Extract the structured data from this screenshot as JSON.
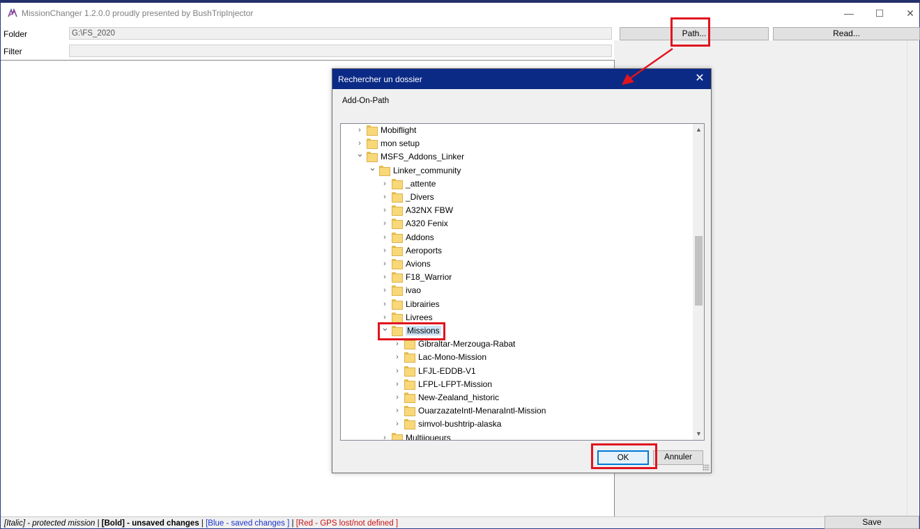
{
  "window": {
    "title": "MissionChanger 1.2.0.0 proudly presented by BushTripInjector",
    "minimize_glyph": "—",
    "maximize_glyph": "☐",
    "close_glyph": "✕"
  },
  "form": {
    "folder_label": "Folder",
    "folder_value": "G:\\FS_2020",
    "filter_label": "Filter",
    "filter_value": ""
  },
  "toolbar": {
    "path_label": "Path...",
    "read_label": "Read..."
  },
  "status": {
    "italic": "[Italic] - protected mission",
    "sep1": " | ",
    "bold": "[Bold] - unsaved changes",
    "sep2": " | ",
    "blue": "[Blue - saved changes ]",
    "sep3": " | ",
    "red": "[Red - GPS lost/not defined ]"
  },
  "save_label": "Save",
  "dialog": {
    "title": "Rechercher un dossier",
    "close_glyph": "✕",
    "description": "Add-On-Path",
    "ok_label": "OK",
    "cancel_label": "Annuler",
    "tree": [
      {
        "label": "Mobiflight",
        "depth": 0,
        "expanded": false
      },
      {
        "label": "mon setup",
        "depth": 0,
        "expanded": false
      },
      {
        "label": "MSFS_Addons_Linker",
        "depth": 0,
        "expanded": true
      },
      {
        "label": "Linker_community",
        "depth": 1,
        "expanded": true
      },
      {
        "label": "_attente",
        "depth": 2,
        "expanded": false
      },
      {
        "label": "_Divers",
        "depth": 2,
        "expanded": false
      },
      {
        "label": "A32NX FBW",
        "depth": 2,
        "expanded": false
      },
      {
        "label": "A320 Fenix",
        "depth": 2,
        "expanded": false
      },
      {
        "label": "Addons",
        "depth": 2,
        "expanded": false
      },
      {
        "label": "Aeroports",
        "depth": 2,
        "expanded": false
      },
      {
        "label": "Avions",
        "depth": 2,
        "expanded": false
      },
      {
        "label": "F18_Warrior",
        "depth": 2,
        "expanded": false
      },
      {
        "label": "ivao",
        "depth": 2,
        "expanded": false
      },
      {
        "label": "Librairies",
        "depth": 2,
        "expanded": false
      },
      {
        "label": "Livrees",
        "depth": 2,
        "expanded": false
      },
      {
        "label": "Missions",
        "depth": 2,
        "expanded": true,
        "selected": true
      },
      {
        "label": "Gibraltar-Merzouga-Rabat",
        "depth": 3,
        "expanded": false
      },
      {
        "label": "Lac-Mono-Mission",
        "depth": 3,
        "expanded": false
      },
      {
        "label": "LFJL-EDDB-V1",
        "depth": 3,
        "expanded": false
      },
      {
        "label": "LFPL-LFPT-Mission",
        "depth": 3,
        "expanded": false
      },
      {
        "label": "New-Zealand_historic",
        "depth": 3,
        "expanded": false
      },
      {
        "label": "OuarzazateIntl-MenaraIntl-Mission",
        "depth": 3,
        "expanded": false
      },
      {
        "label": "simvol-bushtrip-alaska",
        "depth": 3,
        "expanded": false
      },
      {
        "label": "Multijoueurs",
        "depth": 2,
        "expanded": false
      }
    ],
    "scroll": {
      "position": 0.45,
      "visible_fraction": 0.24
    }
  },
  "colors": {
    "annotation_red": "#e0141e",
    "dialog_titlebar": "#0b2a86",
    "selection": "#cce4f7",
    "ok_border": "#0078d7"
  }
}
